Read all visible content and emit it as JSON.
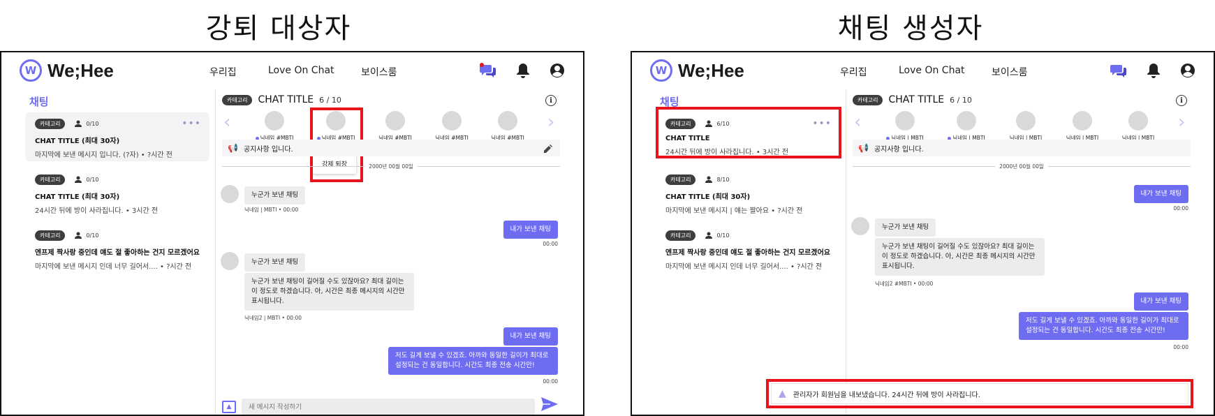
{
  "panels": {
    "left_title": "강퇴 대상자",
    "right_title": "채팅 생성자"
  },
  "app": {
    "logo_text": "We;Hee",
    "nav": [
      "우리집",
      "Love On Chat",
      "보이스룸"
    ],
    "sidebar_title": "채팅",
    "brand_color": "#6e6cf0"
  },
  "left": {
    "rooms": [
      {
        "category": "카테고리",
        "people": "0/10",
        "title": "CHAT TITLE  (최대 30자)",
        "last": "마지막에 보낸 메시지 입니다. (?자)   •   ?시간 전"
      },
      {
        "category": "카테고리",
        "people": "0/10",
        "title": "CHAT TITLE  (최대 30자)",
        "last": "24시간 뒤에 방이 사라집니다.   •   3시간 전"
      },
      {
        "category": "카테고리",
        "people": "0/10",
        "title": "엔프제 짝사랑 중인데 얘도 절 좋아하는 건지 모르겠어요",
        "last": "마지막에 보낸 메시지 인데 너무 길어서....   •   ?시간 전"
      }
    ],
    "chat": {
      "category": "카테고리",
      "title": "CHAT TITLE",
      "count": "6 / 10",
      "members": [
        "닉네임 #MBTI",
        "닉네임 #MBTI",
        "닉네임 #MBTI",
        "닉네임 #MBTI",
        "닉네임 #MBTI"
      ],
      "tooltip": "강제 퇴장",
      "notice": "공지사항 입니다.",
      "date": "2000년 00월 00일",
      "msg_other_1": "누군가 보낸 채팅",
      "meta_1": "닉네임 | MBTI  •  00:00",
      "msg_mine_1": "내가 보낸 채팅",
      "time_1": "00:00",
      "msg_other_2a": "누군가 보낸 채팅",
      "msg_other_2b": "누군가 보낸 채팅이 길어질 수도 있잖아요? 최대 길이는 이 정도로 하겠습니다. 아, 시간은 최종 메시지의 시간만 표시됩니다.",
      "meta_2": "닉네임2 | MBTI  •  00:00",
      "msg_mine_2a": "내가 보낸 채팅",
      "msg_mine_2b": "저도 길게 보낼 수 있겠죠. 아까와 동일한 길이가 최대로 설정되는 건 동일합니다. 시간도 최종 전송 시간만!",
      "time_2": "00:00",
      "input_placeholder": "새 메시지 작성하기"
    }
  },
  "right": {
    "rooms": [
      {
        "category": "카테고리",
        "people": "6/10",
        "title": "CHAT TITLE",
        "last": "24시간 뒤에 방이 사라집니다.   •   3시간 전"
      },
      {
        "category": "카테고리",
        "people": "8/10",
        "title": "CHAT TITLE  (최대 30자)",
        "last": "마지막에 보낸 메시지 |  얘는 짤아요   •   ?시간 전"
      },
      {
        "category": "카테고리",
        "people": "0/10",
        "title": "엔프제 짝사랑 중인데 얘도 절 좋아하는 건지 모르겠어요",
        "last": "마지막에 보낸 메시지 인데 너무 길어서....   •   ?시간 전"
      }
    ],
    "chat": {
      "category": "카테고리",
      "title": "CHAT TITLE",
      "count": "6 / 10",
      "members": [
        "닉네임 | MBTI",
        "닉네임 | MBTI",
        "닉네임 | MBTI",
        "닉네임 | MBTI",
        "닉네임 | MBTI"
      ],
      "notice": "공지사항 입니다.",
      "date": "2000년 00월 00일",
      "msg_mine_1": "내가 보낸 채팅",
      "time_1": "00:00",
      "msg_other_a": "누군가 보낸 채팅",
      "msg_other_b": "누군가 보낸 채팅이 길어질 수도 있잖아요? 최대 길이는 이 정도로 하겠습니다. 아, 시간은 최종 메시지의 시간만 표시됩니다.",
      "meta": "닉네임2 #MBTI  •  00:00",
      "msg_mine_2a": "내가 보낸 채팅",
      "msg_mine_2b": "저도 길게 보낼 수 있겠죠. 아까와 동일한 길이가 최대로 설정되는 건 동일합니다. 시간도 최종 전송 시간만!",
      "time_2": "00:00",
      "warning": "관리자가 회원님을 내보냈습니다. 24시간 뒤에 방이 사라집니다."
    }
  }
}
